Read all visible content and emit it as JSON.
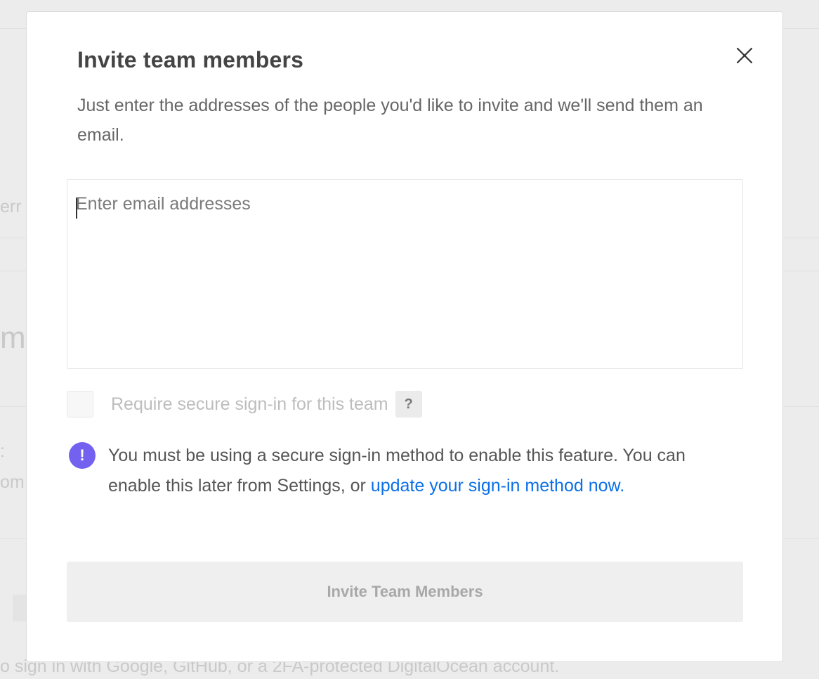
{
  "modal": {
    "title": "Invite team members",
    "description": "Just enter the addresses of the people you'd like to invite and we'll send them an email.",
    "email_placeholder": "Enter email addresses",
    "email_value": "",
    "secure_signin_label": "Require secure sign-in for this team",
    "secure_signin_checked": false,
    "help_badge": "?",
    "notice": {
      "icon": "exclamation-icon",
      "text": "You must be using a secure sign-in method to enable this feature. You can enable this later from Settings, or ",
      "link_text": "update your sign-in method now."
    },
    "invite_button_label": "Invite Team Members",
    "close_icon": "close-icon"
  },
  "background": {
    "fragment_left_1": "err",
    "fragment_left_2": "m",
    "fragment_left_3": ":",
    "fragment_left_4": "om",
    "footer_text": "o sign in with Google, GitHub, or a 2FA-protected DigitalOcean account."
  },
  "colors": {
    "accent_link": "#0a6fe8",
    "notice_icon": "#7362f0",
    "disabled_button_bg": "#efefef"
  }
}
